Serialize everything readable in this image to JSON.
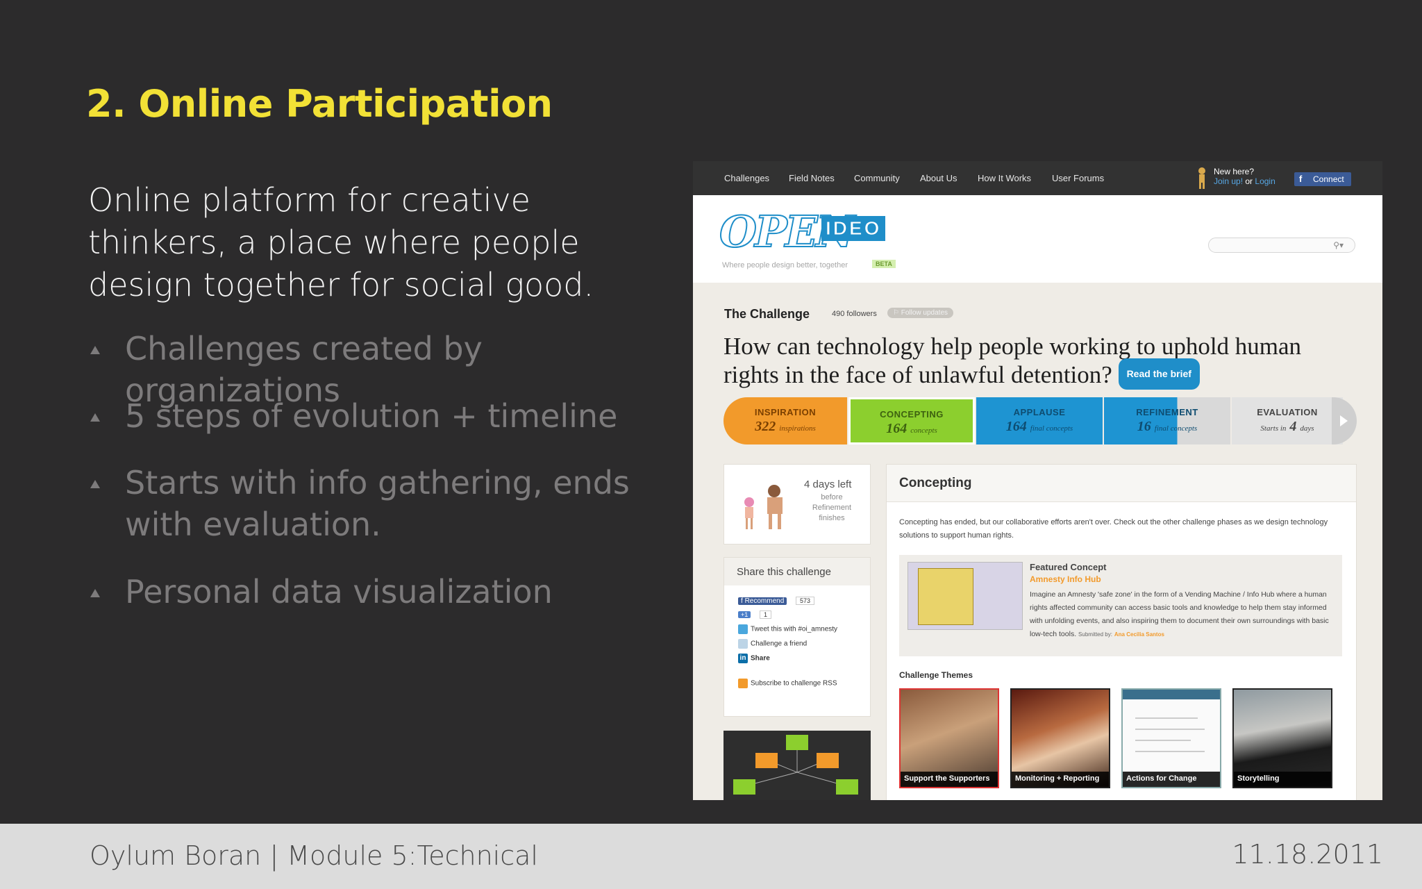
{
  "slide": {
    "title": "2. Online Participation",
    "intro": "Online platform for creative thinkers, a place where people design together for social good.",
    "bullets": [
      "Challenges created by organizations",
      "5 steps of evolution + timeline",
      "Starts with info gathering, ends with evaluation.",
      "Personal data visualization"
    ]
  },
  "footer": {
    "left": "Oylum Boran | Module 5:Technical",
    "right": "11.18.2011"
  },
  "site": {
    "nav": [
      "Challenges",
      "Field Notes",
      "Community",
      "About Us",
      "How It Works",
      "User Forums"
    ],
    "new_here": "New here?",
    "join": "Join up!",
    "or": "or",
    "login": "Login",
    "connect": "Connect",
    "logo_open": "OPEN",
    "logo_ideo": "IDEO",
    "tagline": "Where people design better, together",
    "beta": "BETA",
    "challenge_label": "The Challenge",
    "followers": "490 followers",
    "follow_updates": "Follow updates",
    "question": "How can technology help people working to uphold human rights in the face of unlawful detention?",
    "read_brief": "Read the brief",
    "phases": [
      {
        "name": "INSPIRATION",
        "count": "322",
        "unit": "inspirations"
      },
      {
        "name": "CONCEPTING",
        "count": "164",
        "unit": "concepts"
      },
      {
        "name": "APPLAUSE",
        "count": "164",
        "unit": "final concepts"
      },
      {
        "name": "REFINEMENT",
        "count": "16",
        "unit": "final concepts"
      },
      {
        "name": "EVALUATION",
        "count": "4",
        "prefix": "Starts in",
        "unit": "days"
      }
    ],
    "days_left": "4 days left",
    "days_sub": "before Refinement finishes",
    "share": {
      "title": "Share this challenge",
      "recommend": "Recommend",
      "recommend_count": "573",
      "plus_one": "+1",
      "plus_one_count": "1",
      "tweet": "Tweet this with #oi_amnesty",
      "challenge_friend": "Challenge a friend",
      "linkedin": "Share",
      "rss": "Subscribe to challenge RSS"
    },
    "main": {
      "title": "Concepting",
      "text": "Concepting has ended, but our collaborative efforts aren't over. Check out the other challenge phases as we design technology solutions to support human rights.",
      "featured_title": "Featured Concept",
      "featured_name": "Amnesty Info Hub",
      "featured_desc": "Imagine an Amnesty 'safe zone' in the form of a Vending Machine / Info Hub where a human rights affected community can access basic tools and knowledge to help them stay informed with unfolding events, and also inspiring them to document their own surroundings with basic low-tech tools.",
      "submitted_by": "Submitted by:",
      "author": "Ana Cecilia Santos",
      "themes_title": "Challenge Themes",
      "themes": [
        "Support the Supporters",
        "Monitoring + Reporting",
        "Actions for Change",
        "Storytelling"
      ]
    }
  }
}
